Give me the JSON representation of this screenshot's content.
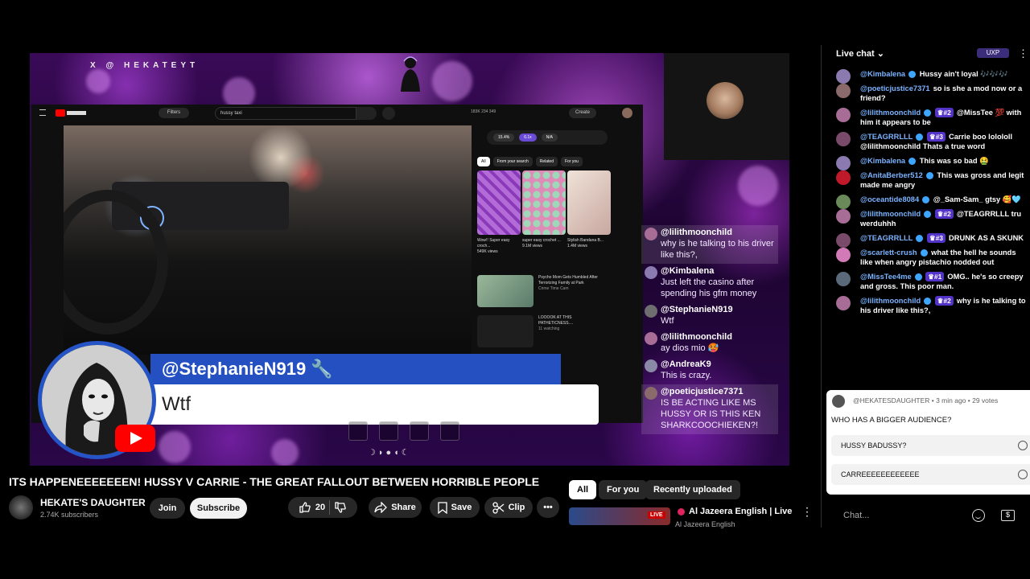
{
  "video": {
    "handle_tag": "X @ HEKATEYT",
    "inner_screen": {
      "filters_label": "Filters",
      "search_value": "hussy taxi",
      "create_label": "Create",
      "stats": "183K  234  349",
      "chips": [
        "15.4%",
        "6.1x",
        "N/A"
      ],
      "tabs": [
        "All",
        "From your search",
        "Related",
        "For you"
      ],
      "thumbs": [
        {
          "title": "Wow!! Super easy croch...",
          "views": "549K views",
          "color": "#b36bd8"
        },
        {
          "title": "super easy crochet ...",
          "views": "9.1M views",
          "color": "#d88ab8"
        },
        {
          "title": "Stylish Bandana B...",
          "views": "1.4M views",
          "color": "#e8d8d0"
        }
      ],
      "rows": [
        {
          "title": "Psycho Mom Gets Humbled After Terrorizing Family at Park",
          "meta": "Crime Time Cam",
          "color": "#7aa07a"
        },
        {
          "title": "LOOOOK AT THIS PATHETICNESS....",
          "meta": "11 watching",
          "color": "#333"
        }
      ]
    },
    "alert": {
      "username": "@StephanieN919 🔧",
      "message": "Wtf"
    },
    "moon_phases": "☽◗●◖☾",
    "overlay_chat": [
      {
        "user": "@lilithmoonchild",
        "text": "why is he talking to his driver like this?,",
        "highlight": true,
        "color": "#a86d96"
      },
      {
        "user": "@Kimbalena",
        "text": "Just left the casino after spending his gfm money",
        "highlight": false,
        "color": "#8a7ab0"
      },
      {
        "user": "@StephanieN919",
        "text": "Wtf",
        "highlight": false,
        "color": "#6e6e6e"
      },
      {
        "user": "@lilithmoonchild",
        "text": "ay dios mio 🥵",
        "highlight": false,
        "color": "#a86d96"
      },
      {
        "user": "@AndreaK9",
        "text": "This is crazy.",
        "highlight": false,
        "color": "#8a8aa8"
      },
      {
        "user": "@poeticjustice7371",
        "text": "IS BE ACTING LIKE MS HUSSY OR IS THIS KEN SHARKCOOCHIEKEN?!",
        "highlight": true,
        "color": "#8a6a6a"
      }
    ]
  },
  "below": {
    "title": "ITS HAPPENEEEEEEEN! HUSSY V CARRIE - THE GREAT FALLOUT BETWEEN HORRIBLE PEOPLE",
    "channel_name": "HEKATE'S DAUGHTER",
    "subscribers": "2.74K subscribers",
    "join_label": "Join",
    "subscribe_label": "Subscribe",
    "like_count": "20",
    "share_label": "Share",
    "save_label": "Save",
    "clip_label": "Clip"
  },
  "related": {
    "chips": [
      "All",
      "For you",
      "Recently uploaded"
    ],
    "item": {
      "title": "Al Jazeera English | Live",
      "channel": "Al Jazeera English",
      "live_badge": "LIVE"
    }
  },
  "live_chat": {
    "header": "Live chat",
    "header_badge": "UXP",
    "messages": [
      {
        "user": "@Kimbalena",
        "badge": "",
        "text": "Hussy ain't loyal 🎶🎶🎶",
        "color": "#8a7ab0"
      },
      {
        "user": "@poeticjustice7371",
        "badge": "",
        "text": "so is she a mod now or a friend?",
        "color": "#8a6a6a"
      },
      {
        "user": "@lilithmoonchild",
        "badge": "#2",
        "text": "@MissTee 💯 with him it appears to be",
        "color": "#a86d96"
      },
      {
        "user": "@TEAGRRLLL",
        "badge": "#3",
        "text": "Carrie boo lolololl @lilithmoonchild Thats a true word",
        "color": "#7a4a6a"
      },
      {
        "user": "@Kimbalena",
        "badge": "",
        "text": "This was so bad 🤮",
        "color": "#8a7ab0"
      },
      {
        "user": "@AnitaBerber512",
        "badge": "",
        "text": "This was gross and legit made me angry",
        "color": "#c01a2a"
      },
      {
        "user": "@oceantide8084",
        "badge": "",
        "text": "@_Sam-Sam_ gtsy 🥰🩵",
        "color": "#6a8a5a"
      },
      {
        "user": "@lilithmoonchild",
        "badge": "#2",
        "text": "@TEAGRRLLL tru werduhhh",
        "color": "#a86d96"
      },
      {
        "user": "@TEAGRRLLL",
        "badge": "#3",
        "text": "DRUNK AS A SKUNK",
        "color": "#7a4a6a"
      },
      {
        "user": "@scarlett-crush",
        "badge": "",
        "text": "what the hell he sounds like when angry pistachio nodded out",
        "color": "#d27ab8"
      },
      {
        "user": "@MissTee4me",
        "badge": "#1",
        "text": "OMG.. he's so creepy and gross. This poor man.",
        "color": "#5a6a7a"
      },
      {
        "user": "@lilithmoonchild",
        "badge": "#2",
        "text": "why is he talking to his driver like this?,",
        "color": "#a86d96"
      }
    ],
    "poll": {
      "meta": "@HEKATESDAUGHTER • 3 min ago • 29 votes",
      "question": "WHO HAS A BIGGER AUDIENCE?",
      "options": [
        "HUSSY BADUSSY?",
        "CARREEEEEEEEEEEE"
      ]
    },
    "input_placeholder": "Chat..."
  }
}
